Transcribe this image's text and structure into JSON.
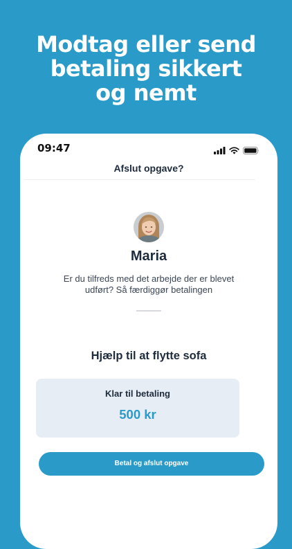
{
  "headline": {
    "line1": "Modtag eller send",
    "line2": "betaling sikkert",
    "line3": "og nemt"
  },
  "status_bar": {
    "time": "09:47",
    "icons": [
      "cellular-signal-icon",
      "wifi-icon",
      "battery-icon"
    ]
  },
  "nav": {
    "title": "Afslut opgave?"
  },
  "user": {
    "name": "Maria",
    "avatar": "user-photo"
  },
  "description": "Er du tilfreds med det arbejde der er blevet udført? Så færdiggør betalingen",
  "task": {
    "title": "Hjælp til at flytte sofa"
  },
  "payment": {
    "label": "Klar til betaling",
    "amount": "500 kr"
  },
  "actions": {
    "pay_button": "Betal og afslut opgave"
  },
  "colors": {
    "brand_blue": "#2a9bc9",
    "dark_text": "#1e2b3c",
    "card_bg": "#e6edf5"
  }
}
